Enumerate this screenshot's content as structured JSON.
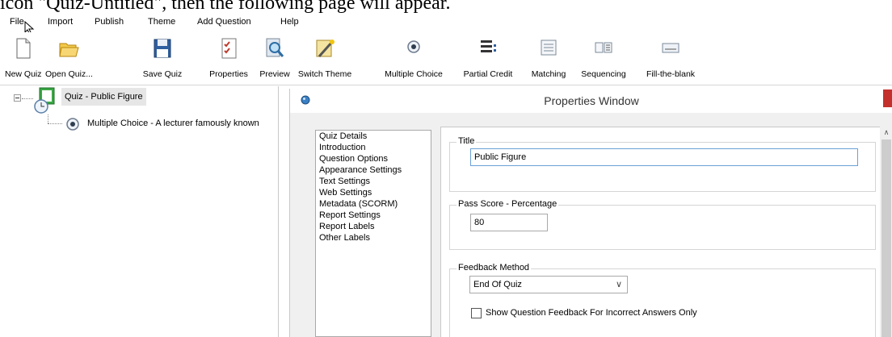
{
  "instruction": "icon \"Quiz-Untitled\", then the following page will appear.",
  "menu": [
    "File",
    "Import",
    "Publish",
    "Theme",
    "Add Question",
    "Help"
  ],
  "toolbar": [
    {
      "label": "New Quiz",
      "icon": "new-document-icon"
    },
    {
      "label": "Open Quiz...",
      "icon": "open-folder-icon"
    },
    {
      "label": "Save Quiz",
      "icon": "save-disk-icon"
    },
    {
      "label": "Properties",
      "icon": "properties-checklist-icon"
    },
    {
      "label": "Preview",
      "icon": "preview-magnifier-icon"
    },
    {
      "label": "Switch Theme",
      "icon": "theme-wand-icon"
    },
    {
      "label": "Multiple Choice",
      "icon": "radio-button-icon"
    },
    {
      "label": "Partial Credit",
      "icon": "partial-credit-icon"
    },
    {
      "label": "Matching",
      "icon": "matching-icon"
    },
    {
      "label": "Sequencing",
      "icon": "sequencing-icon"
    },
    {
      "label": "Fill-the-blank",
      "icon": "fill-blank-icon"
    }
  ],
  "tree": {
    "root_label": "Quiz - Public Figure",
    "child_label": "Multiple Choice - A lecturer famously known"
  },
  "properties": {
    "title": "Properties Window",
    "nav_items": [
      "Quiz Details",
      "Introduction",
      "Question Options",
      "Appearance Settings",
      "Text Settings",
      "Web Settings",
      "Metadata (SCORM)",
      "Report Settings",
      "Report Labels",
      "Other Labels"
    ],
    "title_group": {
      "legend": "Title",
      "value": "Public Figure"
    },
    "pass_group": {
      "legend": "Pass Score - Percentage",
      "value": "80"
    },
    "feedback_group": {
      "legend": "Feedback Method",
      "selected": "End Of Quiz",
      "checkbox_label": "Show Question Feedback For Incorrect Answers Only",
      "checkbox_checked": false
    }
  },
  "colors": {
    "close_button": "#c4302b",
    "focus_border": "#6aa0d6",
    "selection_bg": "#e6e6e6"
  }
}
